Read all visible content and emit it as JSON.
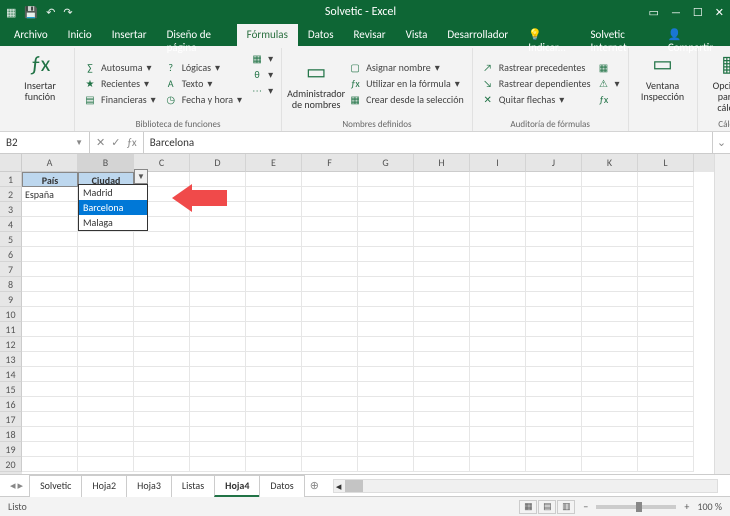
{
  "title": "Solvetic - Excel",
  "account": "Solvetic Internet",
  "share": "Compartir",
  "menus": {
    "file": "Archivo",
    "home": "Inicio",
    "insert": "Insertar",
    "pagelayout": "Diseño de página",
    "formulas": "Fórmulas",
    "data": "Datos",
    "review": "Revisar",
    "view": "Vista",
    "developer": "Desarrollador",
    "tellme": "Indicar..."
  },
  "ribbon": {
    "insert_fn": "Insertar\nfunción",
    "autosum": "Autosuma",
    "recent": "Recientes",
    "financial": "Financieras",
    "logical": "Lógicas",
    "text": "Texto",
    "datetime": "Fecha y hora",
    "lib_label": "Biblioteca de funciones",
    "name_mgr": "Administrador\nde nombres",
    "assign": "Asignar nombre",
    "usef": "Utilizar en la fórmula",
    "create": "Crear desde la selección",
    "names_label": "Nombres definidos",
    "trace_prec": "Rastrear precedentes",
    "trace_dep": "Rastrear dependientes",
    "remove": "Quitar flechas",
    "audit_label": "Auditoría de fórmulas",
    "watch": "Ventana\nInspección",
    "calc": "Opciones para\nel cálculo",
    "calc_label": "Cálculo"
  },
  "namebox": "B2",
  "formula_value": "Barcelona",
  "columns": [
    "A",
    "B",
    "C",
    "D",
    "E",
    "F",
    "G",
    "H",
    "I",
    "J",
    "K",
    "L"
  ],
  "rows": 20,
  "headers": {
    "a": "País",
    "b": "Ciudad"
  },
  "data": {
    "a2": "España",
    "b2": "Barcelona"
  },
  "dropdown": {
    "options": [
      "Madrid",
      "Barcelona",
      "Malaga"
    ],
    "selected": 1
  },
  "sheets": [
    "Solvetic",
    "Hoja2",
    "Hoja3",
    "Listas",
    "Hoja4",
    "Datos"
  ],
  "active_sheet": 4,
  "status": "Listo",
  "zoom": "100 %"
}
